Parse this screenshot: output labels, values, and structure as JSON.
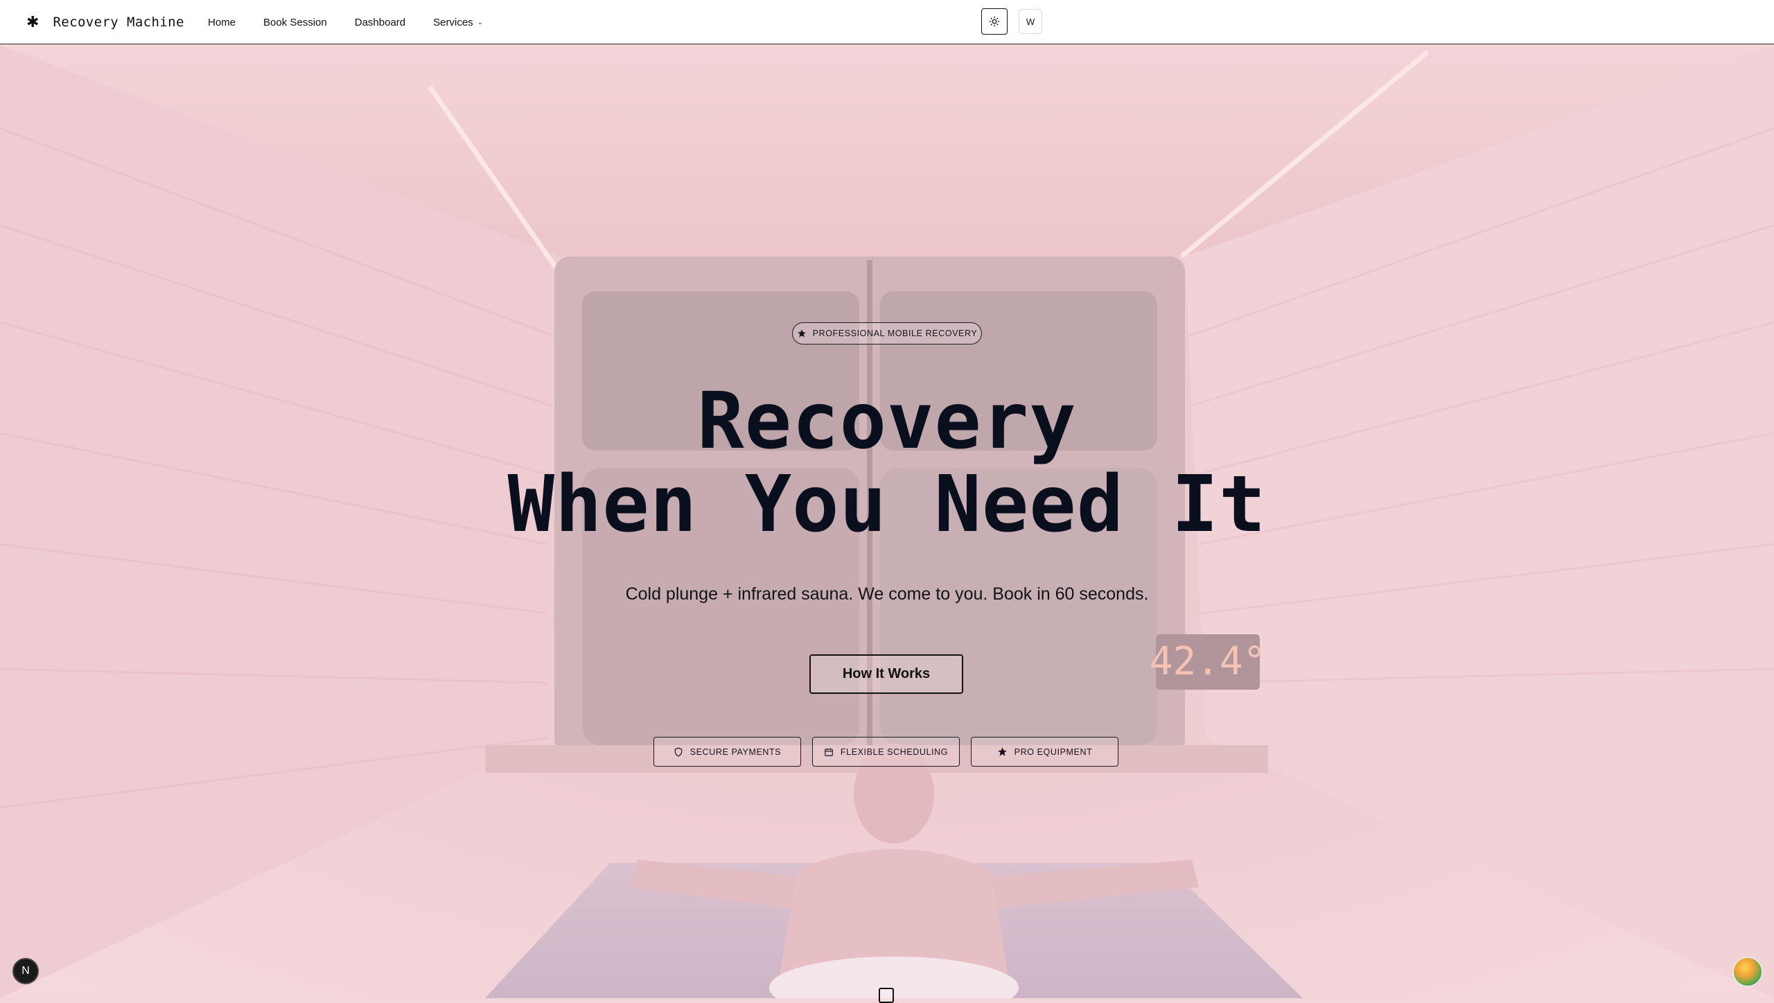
{
  "header": {
    "brand_icon": "✱",
    "brand_name": "Recovery Machine",
    "nav": [
      {
        "label": "Home"
      },
      {
        "label": "Book Session"
      },
      {
        "label": "Dashboard"
      },
      {
        "label": "Services",
        "has_dropdown": true
      }
    ],
    "theme_toggle_icon": "sun-icon",
    "avatar_initial": "W"
  },
  "hero": {
    "badge": "PROFESSIONAL MOBILE RECOVERY",
    "title_line1": "Recovery",
    "title_line2": "When You Need It",
    "subtitle": "Cold plunge + infrared sauna. We come to you. Book in 60 seconds.",
    "cta_label": "How It Works",
    "background_display": "42.4°",
    "features": [
      {
        "label": "SECURE PAYMENTS",
        "icon": "shield-icon"
      },
      {
        "label": "FLEXIBLE SCHEDULING",
        "icon": "calendar-icon"
      },
      {
        "label": "PRO EQUIPMENT",
        "icon": "star-icon"
      }
    ]
  },
  "widgets": {
    "framework_badge": "N"
  },
  "colors": {
    "ink": "#0a0f1e",
    "header_bg": "#ffffff",
    "hero_tint": "#f2d7da"
  }
}
